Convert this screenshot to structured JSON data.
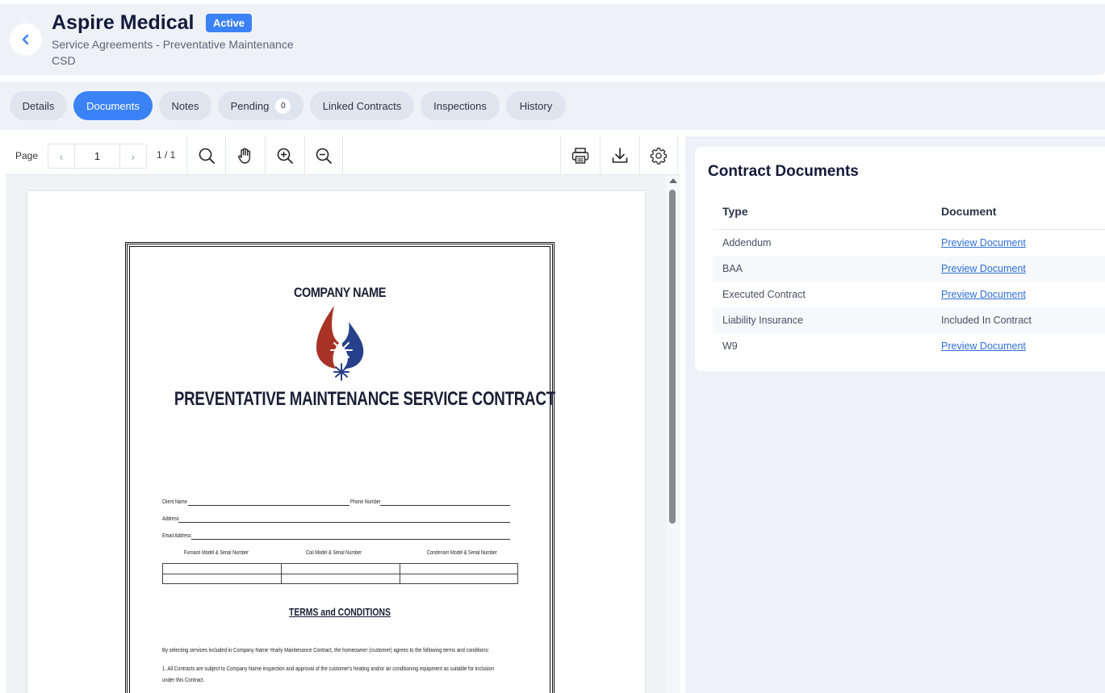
{
  "header": {
    "title": "Aspire Medical",
    "status_badge": "Active",
    "subtitle": "Service Agreements - Preventative Maintenance",
    "subtitle2": "CSD"
  },
  "tabs": [
    {
      "label": "Details"
    },
    {
      "label": "Documents",
      "active": true
    },
    {
      "label": "Notes"
    },
    {
      "label": "Pending",
      "count": "0"
    },
    {
      "label": "Linked Contracts"
    },
    {
      "label": "Inspections"
    },
    {
      "label": "History"
    }
  ],
  "viewer": {
    "page_label": "Page",
    "current_page": "1",
    "page_total": "1 / 1",
    "prev_glyph": "‹",
    "next_glyph": "›",
    "document": {
      "company": "COMPANY NAME",
      "title": "PREVENTATIVE MAINTENANCE SERVICE CONTRACT",
      "client_name_label": "Client Name",
      "phone_label": "Phone Number",
      "address_label": "Address",
      "email_label": "Email Address",
      "col1": "Furnace Model & Serial Number",
      "col2": "Coil Model & Serial Number",
      "col3": "Condenser Model & Serial Number",
      "terms_heading": "TERMS and CONDITIONS",
      "para1": "By selecting services included in Company Name Yearly Maintenance Contract, the homeowner (customer) agrees to the following terms and conditions:",
      "para2a": "1. All Contracts are subject to Company Name inspection and approval of the customer's heating and/or air conditioning equipment as suitable for inclusion",
      "para2b": "under this Contract."
    }
  },
  "documents_panel": {
    "title": "Contract Documents",
    "col_type": "Type",
    "col_document": "Document",
    "rows": [
      {
        "type": "Addendum",
        "document": "Preview Document",
        "link": true
      },
      {
        "type": "BAA",
        "document": "Preview Document",
        "link": true
      },
      {
        "type": "Executed Contract",
        "document": "Preview Document",
        "link": true
      },
      {
        "type": "Liability Insurance",
        "document": "Included In Contract",
        "link": false
      },
      {
        "type": "W9",
        "document": "Preview Document",
        "link": true
      }
    ]
  },
  "colors": {
    "accent": "#3b82f6",
    "link": "#2f6fd9",
    "panel_bg": "#eef2f7",
    "logo_red": "#a83226",
    "logo_blue": "#27408b"
  }
}
